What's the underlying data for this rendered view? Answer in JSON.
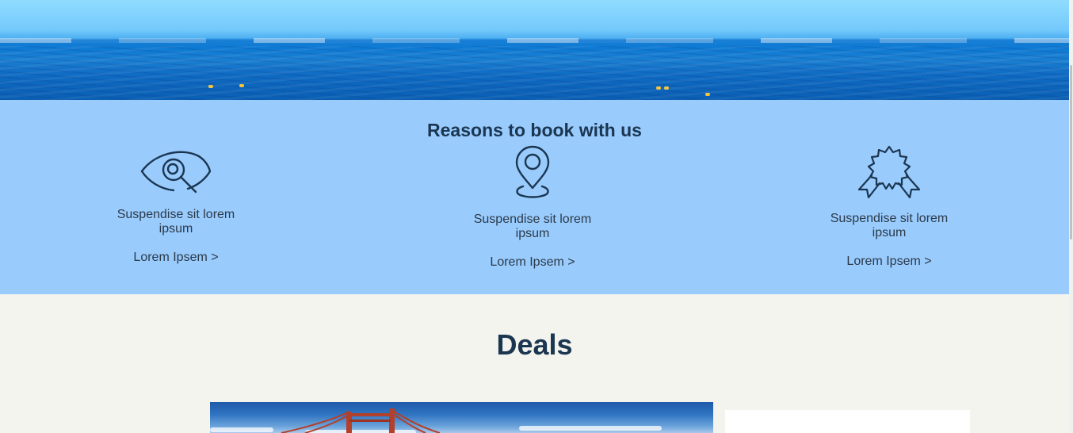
{
  "reasons": {
    "title": "Reasons to book with us",
    "items": [
      {
        "icon": "eye-search-icon",
        "description": "Suspendise sit lorem ipsum",
        "link": "Lorem Ipsem >"
      },
      {
        "icon": "map-pin-icon",
        "description": "Suspendise sit lorem ipsum",
        "link": "Lorem Ipsem >"
      },
      {
        "icon": "award-badge-icon",
        "description": "Suspendise sit lorem ipsum",
        "link": "Lorem Ipsem >"
      }
    ]
  },
  "deals": {
    "title": "Deals"
  },
  "colors": {
    "reasons_bg": "#99cbfd",
    "page_bg": "#f4f4ef",
    "heading": "#1b3650"
  }
}
